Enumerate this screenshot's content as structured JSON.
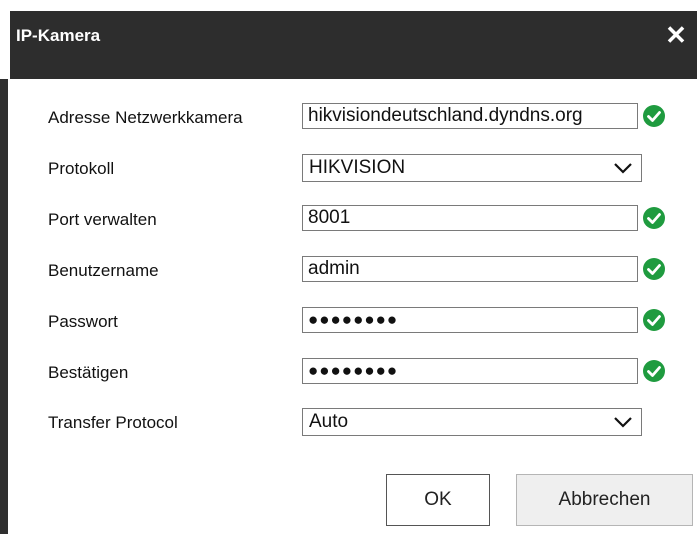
{
  "dialog": {
    "title": "IP-Kamera",
    "close_glyph": "✕"
  },
  "fields": {
    "address": {
      "label": "Adresse Netzwerkkamera",
      "value": "hikvisiondeutschland.dyndns.org",
      "valid_icon": "check-circle-icon"
    },
    "protocol": {
      "label": "Protokoll",
      "value": "HIKVISION"
    },
    "port": {
      "label": "Port verwalten",
      "value": "8001",
      "valid_icon": "check-circle-icon"
    },
    "username": {
      "label": "Benutzername",
      "value": "admin",
      "valid_icon": "check-circle-icon"
    },
    "password": {
      "label": "Passwort",
      "value": "●●●●●●●●",
      "valid_icon": "check-circle-icon"
    },
    "confirm": {
      "label": "Bestätigen",
      "value": "●●●●●●●●",
      "valid_icon": "check-circle-icon"
    },
    "transfer": {
      "label": "Transfer Protocol",
      "value": "Auto"
    }
  },
  "buttons": {
    "ok_label": "OK",
    "cancel_label": "Abbrechen"
  },
  "colors": {
    "titlebar": "#2d2d2d",
    "valid_green": "#1f9b3f"
  }
}
